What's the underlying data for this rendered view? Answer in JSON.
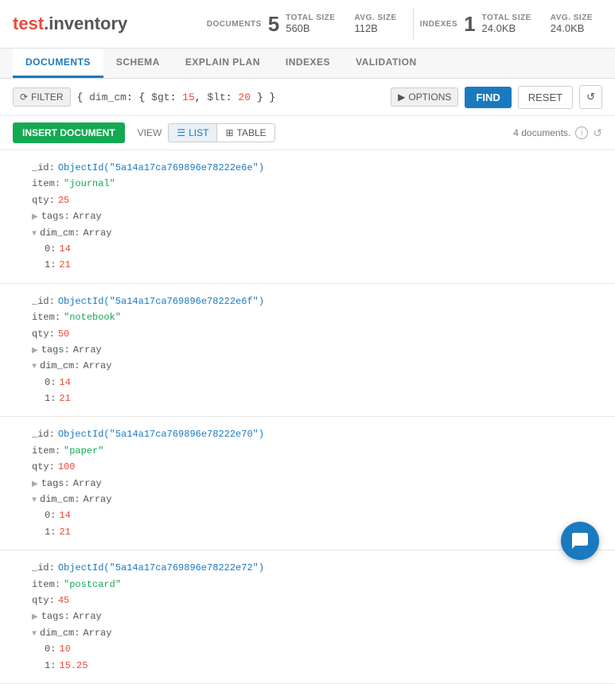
{
  "header": {
    "logo_test": "test",
    "logo_rest": ".inventory",
    "documents_label": "DOCUMENTS",
    "documents_count": "5",
    "total_size_label": "TOTAL SIZE",
    "avg_size_label": "AVG. SIZE",
    "documents_total_size": "560B",
    "documents_avg_size": "112B",
    "indexes_label": "INDEXES",
    "indexes_count": "1",
    "indexes_total_size": "24.0KB",
    "indexes_avg_size": "24.0KB"
  },
  "tabs": [
    {
      "id": "documents",
      "label": "DOCUMENTS",
      "active": true
    },
    {
      "id": "schema",
      "label": "SCHEMA",
      "active": false
    },
    {
      "id": "explain-plan",
      "label": "EXPLAIN PLAN",
      "active": false
    },
    {
      "id": "indexes",
      "label": "INDEXES",
      "active": false
    },
    {
      "id": "validation",
      "label": "VALIDATION",
      "active": false
    }
  ],
  "filter": {
    "button_label": "FILTER",
    "query_prefix": "{ dim_cm: { $gt:",
    "query_15": "15",
    "query_middle": ", $lt:",
    "query_20": "20",
    "query_suffix": "} }",
    "options_label": "OPTIONS",
    "find_label": "FIND",
    "reset_label": "RESET"
  },
  "actionbar": {
    "insert_label": "INSERT DOCUMENT",
    "view_label": "VIEW",
    "list_label": "LIST",
    "table_label": "TABLE",
    "doc_count": "4 documents."
  },
  "documents": [
    {
      "id": "5a14a17ca769896e78222e6e",
      "item": "journal",
      "qty": "25",
      "tags_type": "Array",
      "dim_cm_type": "Array",
      "dim_0": "14",
      "dim_1": "21"
    },
    {
      "id": "5a14a17ca769896e78222e6f",
      "item": "notebook",
      "qty": "50",
      "tags_type": "Array",
      "dim_cm_type": "Array",
      "dim_0": "14",
      "dim_1": "21"
    },
    {
      "id": "5a14a17ca769896e78222e70",
      "item": "paper",
      "qty": "100",
      "tags_type": "Array",
      "dim_cm_type": "Array",
      "dim_0": "14",
      "dim_1": "21"
    },
    {
      "id": "5a14a17ca769896e78222e72",
      "item": "postcard",
      "qty": "45",
      "tags_type": "Array",
      "dim_cm_type": "Array",
      "dim_0": "10",
      "dim_1": "15.25"
    }
  ]
}
